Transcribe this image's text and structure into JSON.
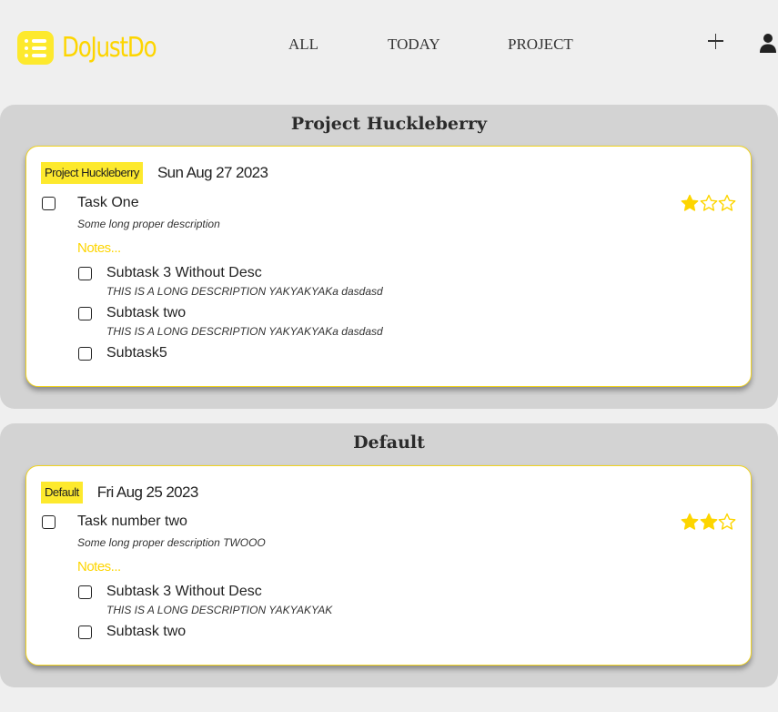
{
  "app": {
    "title": "DoJustDo",
    "brand_color": "#fdd500",
    "accent_color": "#fde92d"
  },
  "nav": {
    "all": "ALL",
    "today": "TODAY",
    "project": "PROJECT",
    "add_icon": "plus-icon",
    "user_icon": "user-icon"
  },
  "projects": [
    {
      "title": "Project Huckleberry",
      "task": {
        "tag": "Project Huckleberry",
        "date": "Sun Aug 27 2023",
        "title": "Task One",
        "description": "Some long proper description",
        "notes_label": "Notes...",
        "priority": 1,
        "priority_max": 3,
        "subtasks": [
          {
            "title": "Subtask 3 Without Desc",
            "description": "THIS IS A LONG DESCRIPTION YAKYAKYAKa dasdasd"
          },
          {
            "title": "Subtask two",
            "description": "THIS IS A LONG DESCRIPTION YAKYAKYAKa dasdasd"
          },
          {
            "title": "Subtask5",
            "description": ""
          }
        ]
      }
    },
    {
      "title": "Default",
      "task": {
        "tag": "Default",
        "date": "Fri Aug 25 2023",
        "title": "Task number two",
        "description": "Some long proper description TWOOO",
        "notes_label": "Notes...",
        "priority": 2,
        "priority_max": 3,
        "subtasks": [
          {
            "title": "Subtask 3 Without Desc",
            "description": "THIS IS A LONG DESCRIPTION YAKYAKYAK"
          },
          {
            "title": "Subtask two",
            "description": ""
          }
        ]
      }
    }
  ]
}
